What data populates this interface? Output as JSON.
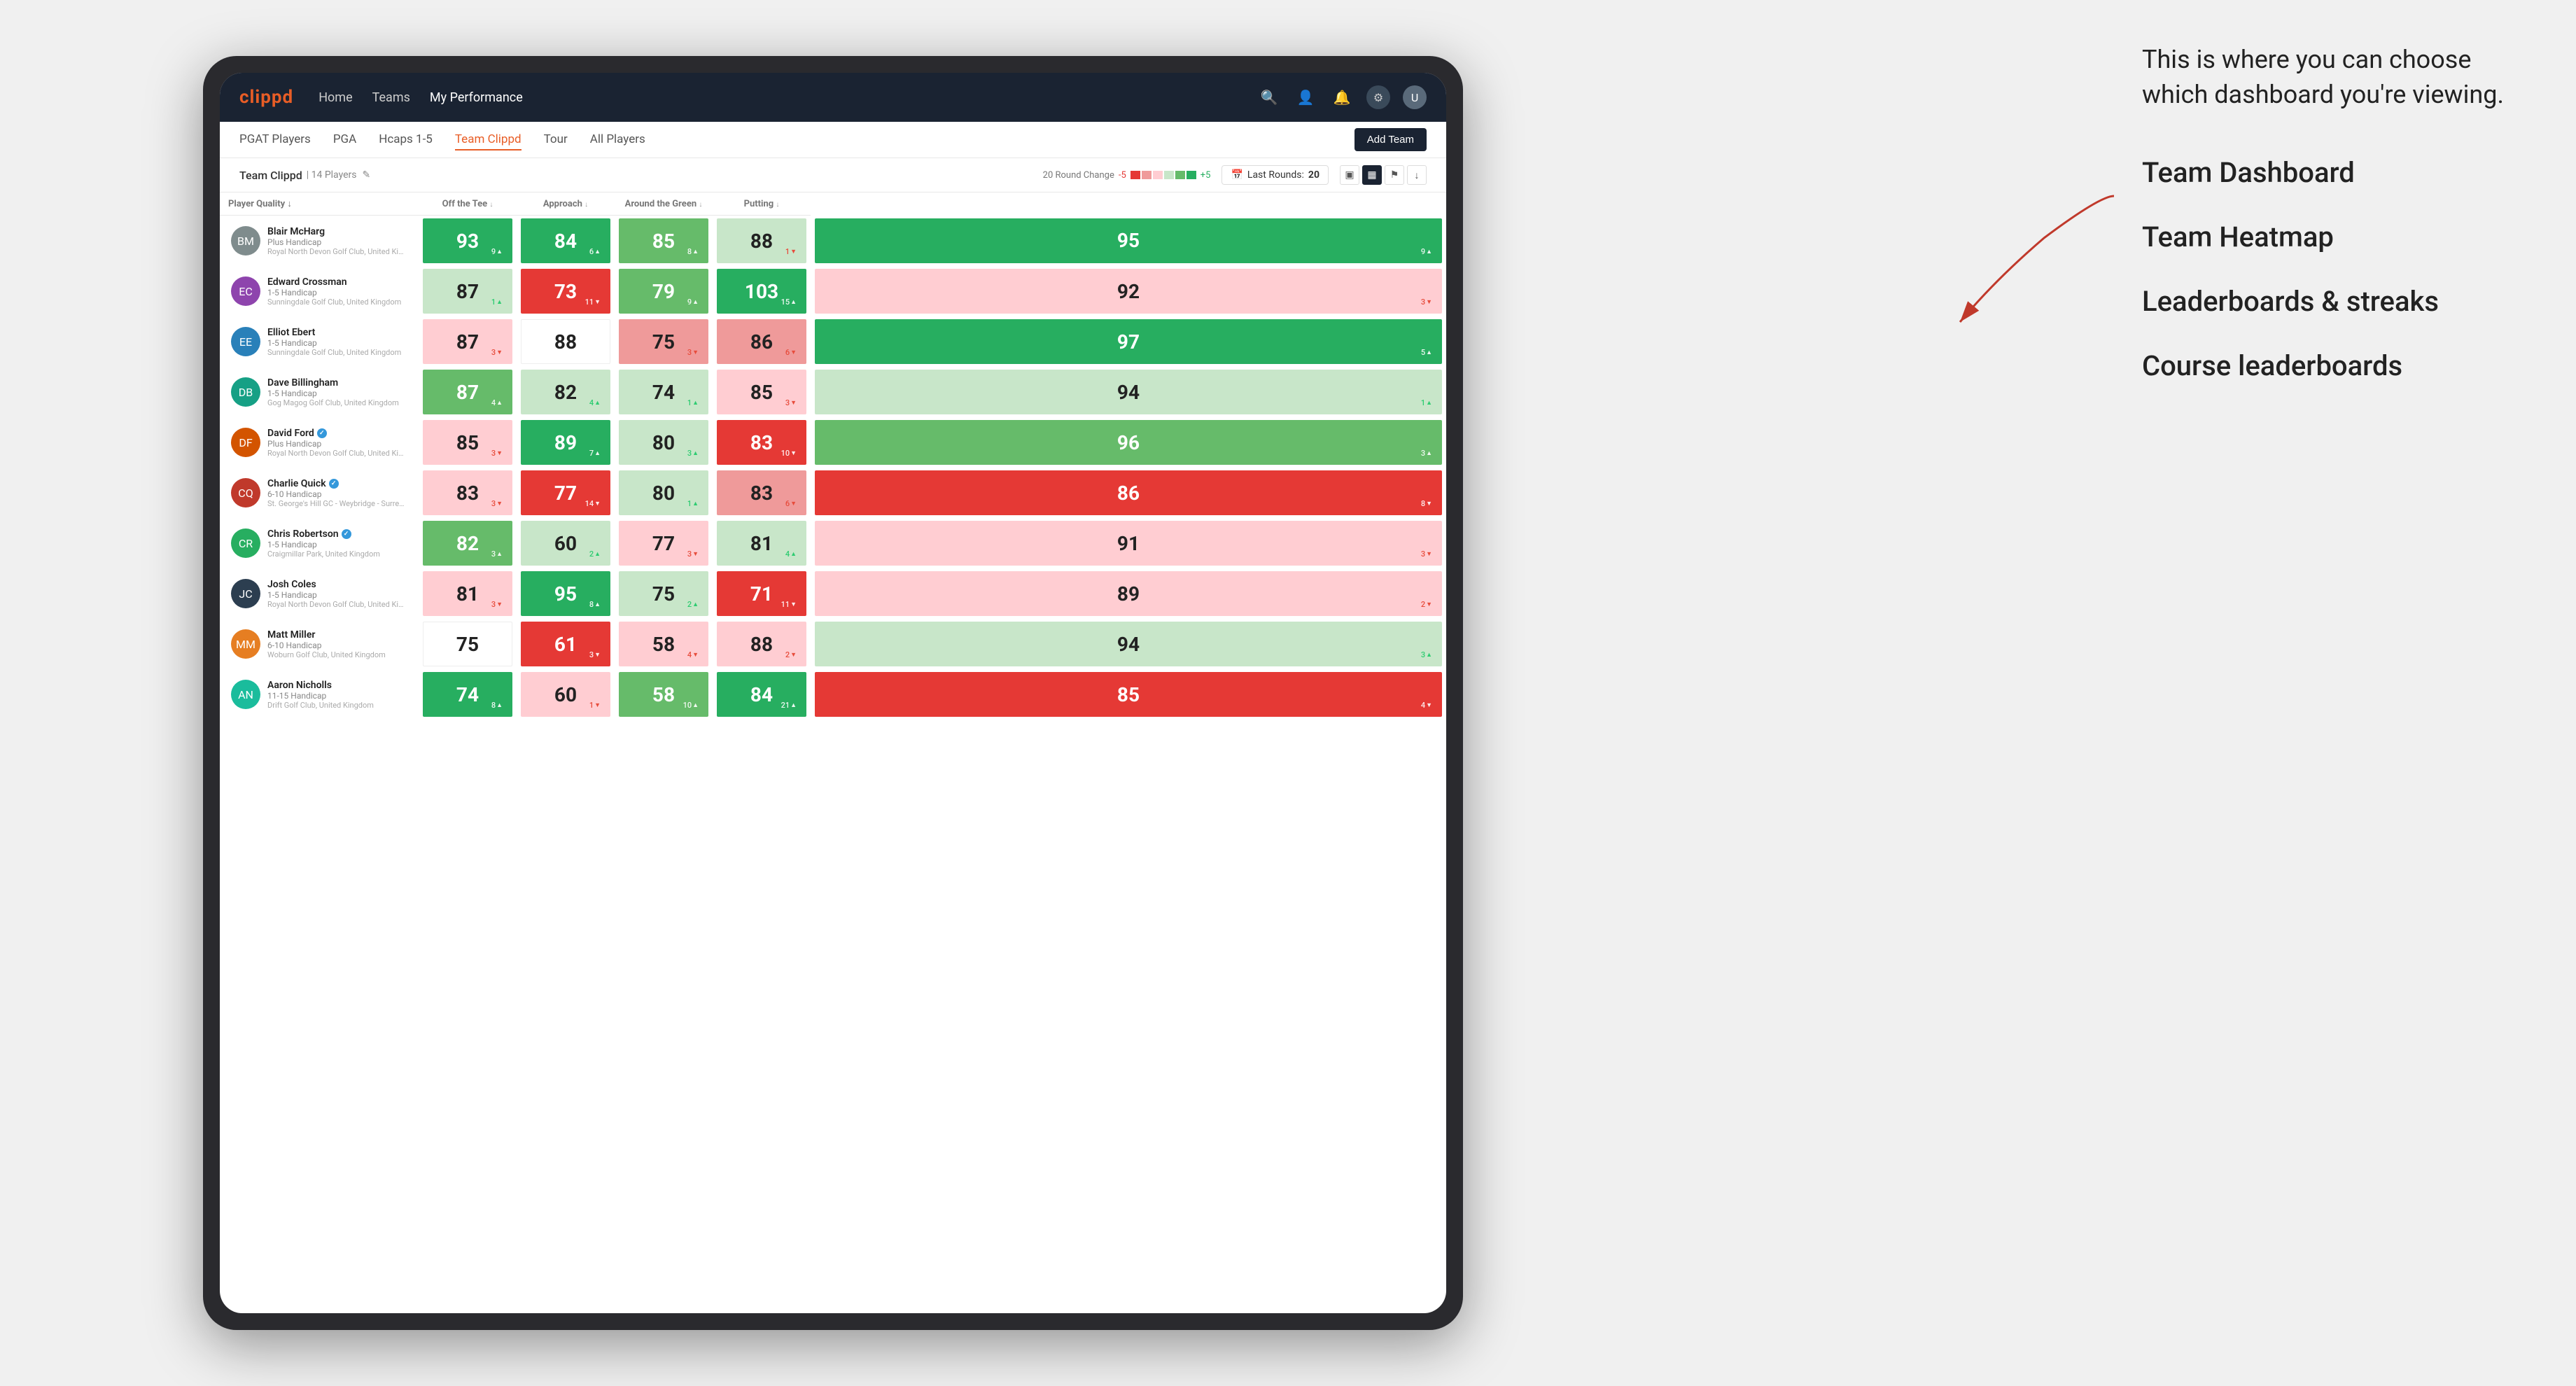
{
  "annotation": {
    "intro_text": "This is where you can choose which dashboard you're viewing.",
    "options": [
      "Team Dashboard",
      "Team Heatmap",
      "Leaderboards & streaks",
      "Course leaderboards"
    ]
  },
  "navbar": {
    "brand": "clippd",
    "links": [
      "Home",
      "Teams",
      "My Performance"
    ],
    "active_link": "My Performance"
  },
  "subnav": {
    "links": [
      "PGAT Players",
      "PGA",
      "Hcaps 1-5",
      "Team Clippd",
      "Tour",
      "All Players"
    ],
    "active_link": "Team Clippd",
    "add_team_label": "Add Team"
  },
  "team_header": {
    "name": "Team Clippd",
    "separator": "|",
    "count_label": "14 Players",
    "round_change_label": "20 Round Change",
    "neg_label": "-5",
    "pos_label": "+5",
    "last_rounds_label": "Last Rounds:",
    "last_rounds_value": "20"
  },
  "table": {
    "column_headers": [
      {
        "key": "player",
        "label": "Player Quality"
      },
      {
        "key": "tee",
        "label": "Off the Tee"
      },
      {
        "key": "approach",
        "label": "Approach"
      },
      {
        "key": "around",
        "label": "Around the Green"
      },
      {
        "key": "putting",
        "label": "Putting"
      }
    ],
    "players": [
      {
        "name": "Blair McHarg",
        "handicap": "Plus Handicap",
        "club": "Royal North Devon Golf Club, United Kingdom",
        "scores": [
          {
            "value": "93",
            "delta": "9",
            "dir": "up",
            "bg": "green-dark"
          },
          {
            "value": "84",
            "delta": "6",
            "dir": "up",
            "bg": "green-dark"
          },
          {
            "value": "85",
            "delta": "8",
            "dir": "up",
            "bg": "green-med"
          },
          {
            "value": "88",
            "delta": "1",
            "dir": "down",
            "bg": "green-light"
          },
          {
            "value": "95",
            "delta": "9",
            "dir": "up",
            "bg": "green-dark"
          }
        ]
      },
      {
        "name": "Edward Crossman",
        "handicap": "1-5 Handicap",
        "club": "Sunningdale Golf Club, United Kingdom",
        "scores": [
          {
            "value": "87",
            "delta": "1",
            "dir": "up",
            "bg": "green-light"
          },
          {
            "value": "73",
            "delta": "11",
            "dir": "down",
            "bg": "red-dark"
          },
          {
            "value": "79",
            "delta": "9",
            "dir": "up",
            "bg": "green-med"
          },
          {
            "value": "103",
            "delta": "15",
            "dir": "up",
            "bg": "green-dark"
          },
          {
            "value": "92",
            "delta": "3",
            "dir": "down",
            "bg": "red-light"
          }
        ]
      },
      {
        "name": "Elliot Ebert",
        "handicap": "1-5 Handicap",
        "club": "Sunningdale Golf Club, United Kingdom",
        "scores": [
          {
            "value": "87",
            "delta": "3",
            "dir": "down",
            "bg": "red-light"
          },
          {
            "value": "88",
            "delta": "",
            "dir": "none",
            "bg": "white"
          },
          {
            "value": "75",
            "delta": "3",
            "dir": "down",
            "bg": "red-med"
          },
          {
            "value": "86",
            "delta": "6",
            "dir": "down",
            "bg": "red-med"
          },
          {
            "value": "97",
            "delta": "5",
            "dir": "up",
            "bg": "green-dark"
          }
        ]
      },
      {
        "name": "Dave Billingham",
        "handicap": "1-5 Handicap",
        "club": "Gog Magog Golf Club, United Kingdom",
        "scores": [
          {
            "value": "87",
            "delta": "4",
            "dir": "up",
            "bg": "green-med"
          },
          {
            "value": "82",
            "delta": "4",
            "dir": "up",
            "bg": "green-light"
          },
          {
            "value": "74",
            "delta": "1",
            "dir": "up",
            "bg": "green-light"
          },
          {
            "value": "85",
            "delta": "3",
            "dir": "down",
            "bg": "red-light"
          },
          {
            "value": "94",
            "delta": "1",
            "dir": "up",
            "bg": "green-light"
          }
        ]
      },
      {
        "name": "David Ford",
        "badge": true,
        "handicap": "Plus Handicap",
        "club": "Royal North Devon Golf Club, United Kingdom",
        "scores": [
          {
            "value": "85",
            "delta": "3",
            "dir": "down",
            "bg": "red-light"
          },
          {
            "value": "89",
            "delta": "7",
            "dir": "up",
            "bg": "green-dark"
          },
          {
            "value": "80",
            "delta": "3",
            "dir": "up",
            "bg": "green-light"
          },
          {
            "value": "83",
            "delta": "10",
            "dir": "down",
            "bg": "red-dark"
          },
          {
            "value": "96",
            "delta": "3",
            "dir": "up",
            "bg": "green-med"
          }
        ]
      },
      {
        "name": "Charlie Quick",
        "badge": true,
        "handicap": "6-10 Handicap",
        "club": "St. George's Hill GC - Weybridge - Surrey, Uni...",
        "scores": [
          {
            "value": "83",
            "delta": "3",
            "dir": "down",
            "bg": "red-light"
          },
          {
            "value": "77",
            "delta": "14",
            "dir": "down",
            "bg": "red-dark"
          },
          {
            "value": "80",
            "delta": "1",
            "dir": "up",
            "bg": "green-light"
          },
          {
            "value": "83",
            "delta": "6",
            "dir": "down",
            "bg": "red-med"
          },
          {
            "value": "86",
            "delta": "8",
            "dir": "down",
            "bg": "red-dark"
          }
        ]
      },
      {
        "name": "Chris Robertson",
        "badge": true,
        "handicap": "1-5 Handicap",
        "club": "Craigmillar Park, United Kingdom",
        "scores": [
          {
            "value": "82",
            "delta": "3",
            "dir": "up",
            "bg": "green-med"
          },
          {
            "value": "60",
            "delta": "2",
            "dir": "up",
            "bg": "green-light"
          },
          {
            "value": "77",
            "delta": "3",
            "dir": "down",
            "bg": "red-light"
          },
          {
            "value": "81",
            "delta": "4",
            "dir": "up",
            "bg": "green-light"
          },
          {
            "value": "91",
            "delta": "3",
            "dir": "down",
            "bg": "red-light"
          }
        ]
      },
      {
        "name": "Josh Coles",
        "handicap": "1-5 Handicap",
        "club": "Royal North Devon Golf Club, United Kingdom",
        "scores": [
          {
            "value": "81",
            "delta": "3",
            "dir": "down",
            "bg": "red-light"
          },
          {
            "value": "95",
            "delta": "8",
            "dir": "up",
            "bg": "green-dark"
          },
          {
            "value": "75",
            "delta": "2",
            "dir": "up",
            "bg": "green-light"
          },
          {
            "value": "71",
            "delta": "11",
            "dir": "down",
            "bg": "red-dark"
          },
          {
            "value": "89",
            "delta": "2",
            "dir": "down",
            "bg": "red-light"
          }
        ]
      },
      {
        "name": "Matt Miller",
        "handicap": "6-10 Handicap",
        "club": "Woburn Golf Club, United Kingdom",
        "scores": [
          {
            "value": "75",
            "delta": "",
            "dir": "none",
            "bg": "white"
          },
          {
            "value": "61",
            "delta": "3",
            "dir": "down",
            "bg": "red-dark"
          },
          {
            "value": "58",
            "delta": "4",
            "dir": "down",
            "bg": "red-light"
          },
          {
            "value": "88",
            "delta": "2",
            "dir": "down",
            "bg": "red-light"
          },
          {
            "value": "94",
            "delta": "3",
            "dir": "up",
            "bg": "green-light"
          }
        ]
      },
      {
        "name": "Aaron Nicholls",
        "handicap": "11-15 Handicap",
        "club": "Drift Golf Club, United Kingdom",
        "scores": [
          {
            "value": "74",
            "delta": "8",
            "dir": "up",
            "bg": "green-dark"
          },
          {
            "value": "60",
            "delta": "1",
            "dir": "down",
            "bg": "red-light"
          },
          {
            "value": "58",
            "delta": "10",
            "dir": "up",
            "bg": "green-med"
          },
          {
            "value": "84",
            "delta": "21",
            "dir": "up",
            "bg": "green-dark"
          },
          {
            "value": "85",
            "delta": "4",
            "dir": "down",
            "bg": "red-dark"
          }
        ]
      }
    ]
  },
  "colors": {
    "green_dark": "#27ae60",
    "green_med": "#66bb6a",
    "green_light": "#c8e6c9",
    "white": "#ffffff",
    "red_light": "#ffcdd2",
    "red_med": "#ef9a9a",
    "red_dark": "#e53935",
    "navbar_bg": "#1a2332",
    "brand_color": "#e85d26"
  }
}
